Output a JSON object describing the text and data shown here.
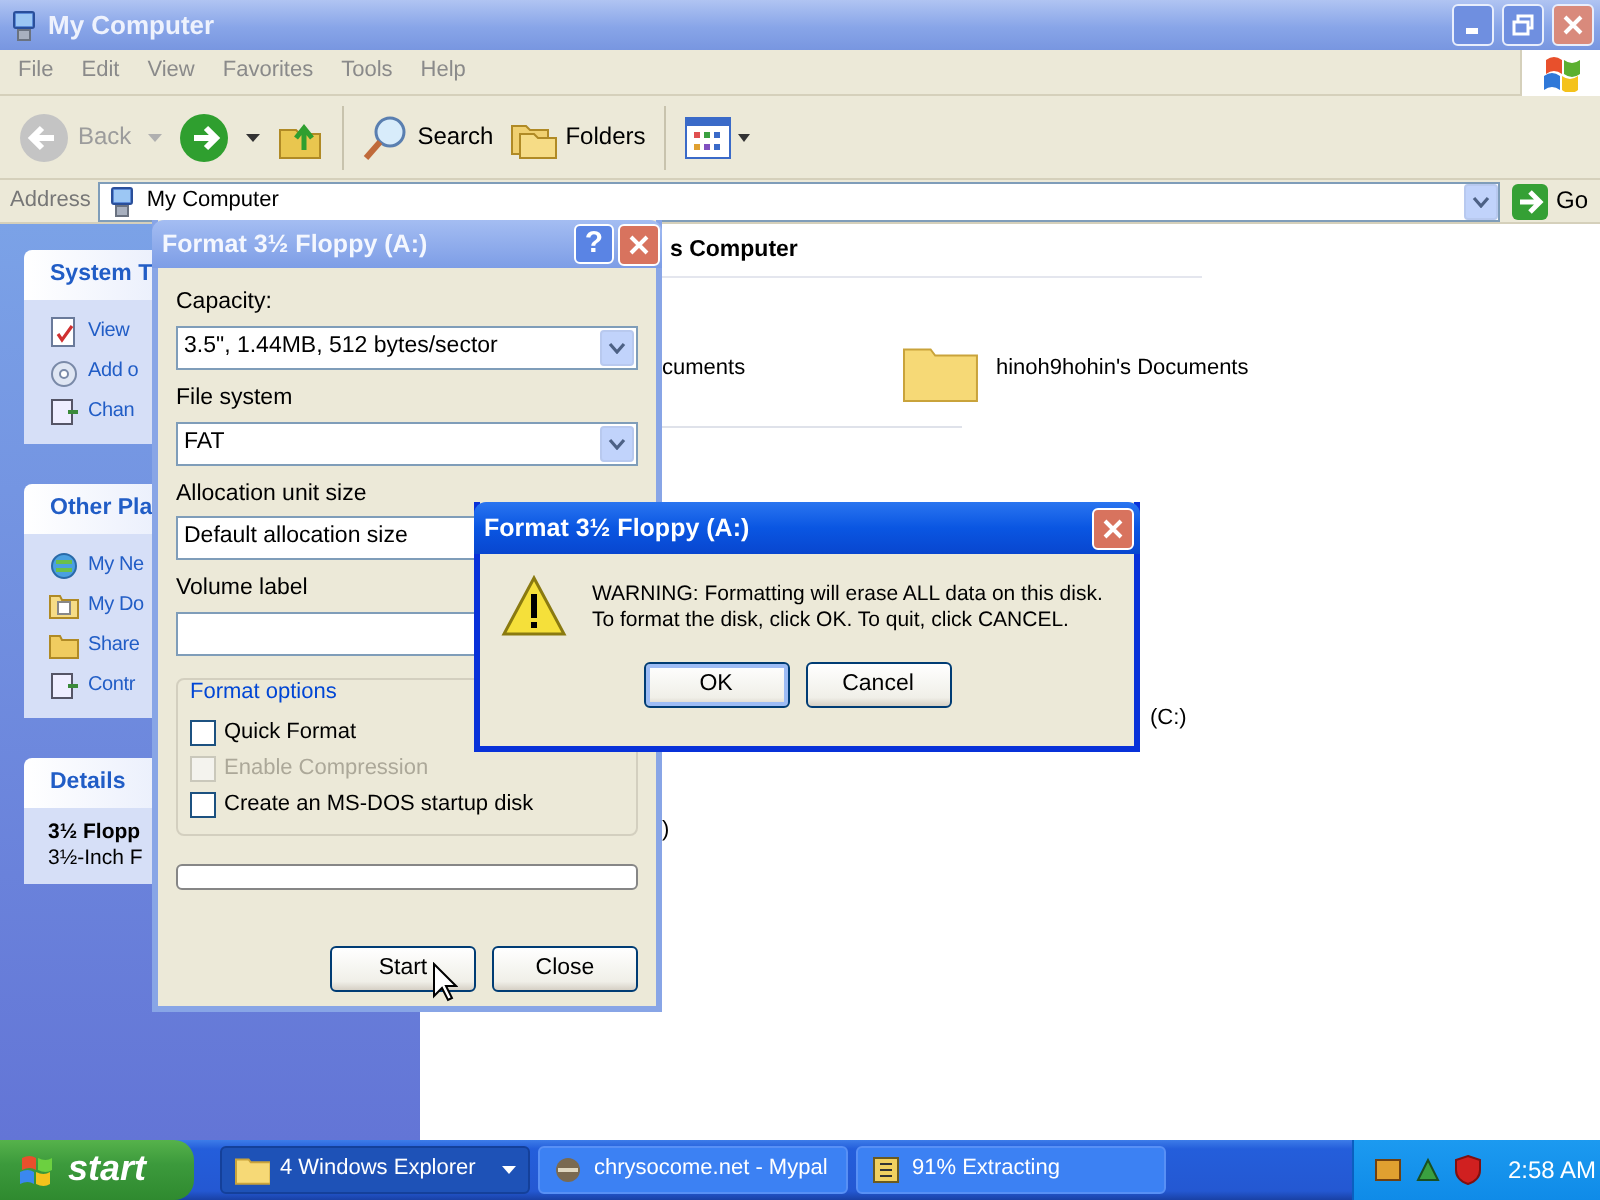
{
  "explorer": {
    "title": "My Computer",
    "menu": [
      "File",
      "Edit",
      "View",
      "Favorites",
      "Tools",
      "Help"
    ],
    "toolbar": {
      "back": {
        "label": "Back",
        "disabled": true
      },
      "search": "Search",
      "folders": "Folders"
    },
    "address": {
      "label": "Address",
      "value": "My Computer",
      "go": "Go"
    },
    "panels": [
      {
        "title": "System T",
        "items": [
          "View",
          "Add o",
          "Chan"
        ]
      },
      {
        "title": "Other Pla",
        "items": [
          "My Ne",
          "My Do",
          "Share",
          "Contr"
        ]
      },
      {
        "title": "Details",
        "lines": [
          "3½ Flopp",
          "3½-Inch F"
        ]
      }
    ],
    "content": {
      "header": "s Computer",
      "items": [
        {
          "kind": "text",
          "label": "cuments"
        },
        {
          "kind": "folder",
          "label": "hinoh9hohin's Documents"
        },
        {
          "kind": "text",
          "label": "(C:)"
        },
        {
          "kind": "text",
          "label": ")"
        }
      ]
    }
  },
  "format_dialog": {
    "title": "Format 3½ Floppy (A:)",
    "help": "?",
    "fields": [
      {
        "kind": "dropdown",
        "label": "Capacity:",
        "value": "3.5\",  1.44MB, 512 bytes/sector"
      },
      {
        "kind": "dropdown",
        "label": "File system",
        "value": "FAT"
      },
      {
        "kind": "input",
        "label": "Allocation unit size",
        "value": "Default allocation size"
      },
      {
        "kind": "input",
        "label": "Volume label"
      }
    ],
    "options": {
      "legend": "Format options",
      "checkboxes": [
        {
          "label": "Quick Format",
          "checked": false,
          "disabled": false
        },
        {
          "label": "Enable Compression",
          "checked": false,
          "disabled": true
        },
        {
          "label": "Create an MS-DOS startup disk",
          "checked": false,
          "disabled": false
        }
      ]
    },
    "progress": {
      "level": 0
    },
    "buttons": [
      "Start",
      "Close"
    ]
  },
  "warning_dialog": {
    "title": "Format 3½ Floppy (A:)",
    "lines": [
      "WARNING: Formatting will erase ALL data on this disk.",
      "To format the disk, click OK. To quit, click CANCEL."
    ],
    "buttons": [
      {
        "label": "OK",
        "default": true
      },
      {
        "label": "Cancel",
        "default": false
      }
    ]
  },
  "taskbar": {
    "start": "start",
    "tasks": [
      {
        "label": "4 Windows Explorer",
        "selected": true,
        "dropdown": true
      },
      {
        "label": "chrysocome.net - Mypal",
        "selected": false,
        "dropdown": false
      },
      {
        "label": "91% Extracting",
        "selected": false,
        "dropdown": false
      }
    ],
    "clock": "2:58 AM"
  }
}
